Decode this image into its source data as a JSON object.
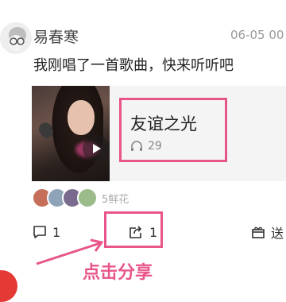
{
  "post": {
    "username": "易春寒",
    "timestamp": "06-05 00",
    "text": "我刚唱了一首歌曲，快来听听吧"
  },
  "song": {
    "title": "友谊之光",
    "plays": "29"
  },
  "flowers": {
    "count_label": "5鲜花"
  },
  "actions": {
    "comment_count": "1",
    "share_count": "1",
    "gift_label": "送"
  },
  "annotation": {
    "text": "点击分享"
  },
  "colors": {
    "highlight": "#e8558a"
  }
}
